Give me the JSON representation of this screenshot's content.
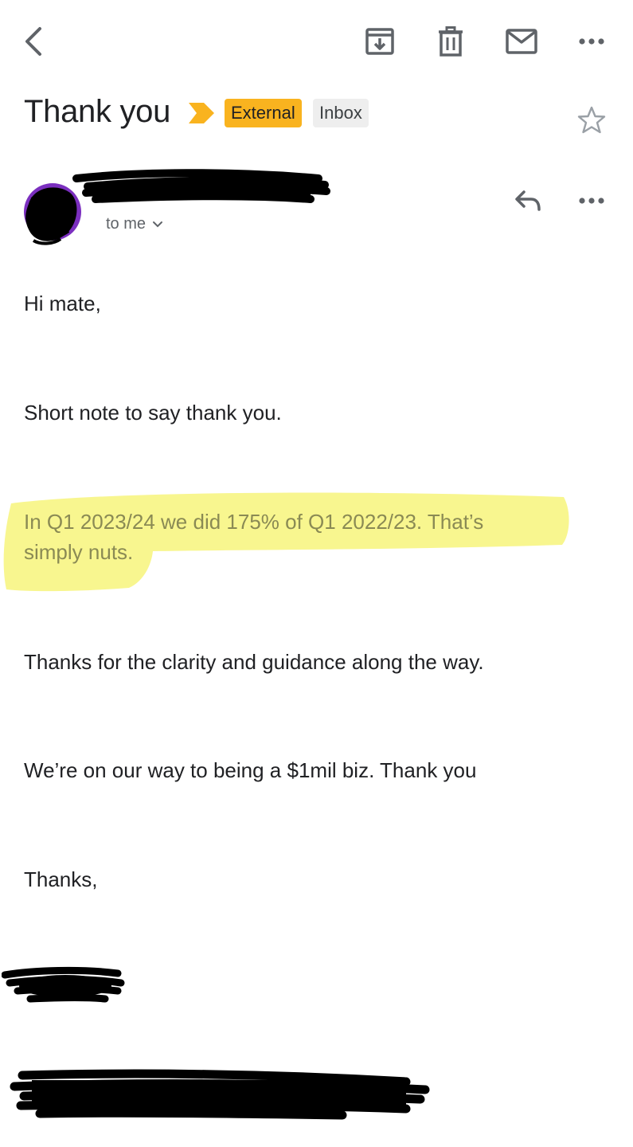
{
  "toolbar": {
    "back_icon": "back-arrow-icon",
    "archive_icon": "archive-icon",
    "delete_icon": "trash-icon",
    "mark_unread_icon": "mail-icon",
    "more_icon": "more-horizontal-icon"
  },
  "email": {
    "subject": "Thank you",
    "labels": [
      "External",
      "Inbox"
    ],
    "importance_icon": "importance-marker-icon",
    "star_icon": "star-outline-icon",
    "recipient_text": "to me",
    "reply_icon": "reply-icon",
    "body": {
      "greeting": "Hi mate,",
      "line1": "Short note to say thank you.",
      "highlight_line1": "In Q1 2023/24 we did 175% of Q1 2022/23. That’s",
      "highlight_line2": "simply nuts.",
      "line3": "Thanks for the clarity and guidance along the way.",
      "line4": "We’re on our way to being a $1mil biz. Thank you",
      "signoff": "Thanks,"
    }
  },
  "colors": {
    "external_label": "#f9b31f",
    "inbox_label": "#eeeeee",
    "importance_marker": "#f9b31f",
    "highlight": "#f5f36a",
    "avatar_ring": "#7b2fbf",
    "redaction": "#000000"
  }
}
